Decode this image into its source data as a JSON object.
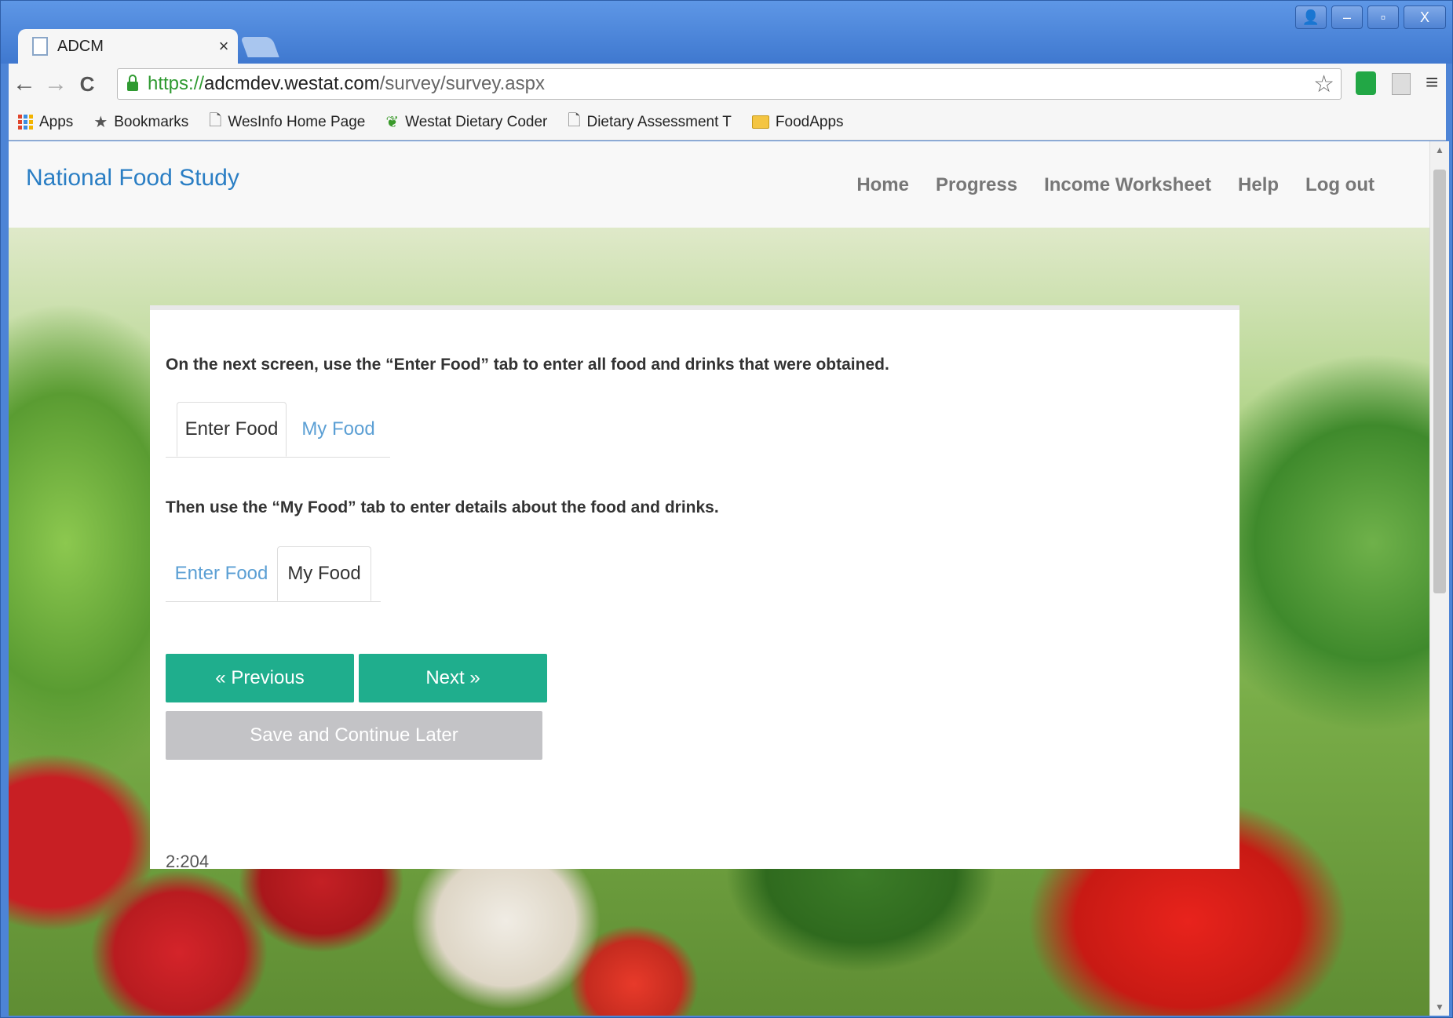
{
  "browser": {
    "tab_title": "ADCM",
    "tab_close": "×",
    "url_scheme": "https://",
    "url_host": "adcmdev.westat.com",
    "url_path": "/survey/survey.aspx",
    "window_controls": {
      "user": "👤",
      "minimize": "–",
      "maximize": "▫",
      "close": "X"
    },
    "nav": {
      "back": "←",
      "forward": "→",
      "reload": "C"
    },
    "star": "☆",
    "menu": "≡",
    "bookmarks": [
      {
        "label": "Apps"
      },
      {
        "label": "Bookmarks"
      },
      {
        "label": "WesInfo Home Page"
      },
      {
        "label": "Westat Dietary Coder"
      },
      {
        "label": "Dietary Assessment T"
      },
      {
        "label": "FoodApps"
      }
    ]
  },
  "site": {
    "brand": "National Food Study",
    "nav": [
      "Home",
      "Progress",
      "Income Worksheet",
      "Help",
      "Log out"
    ]
  },
  "content": {
    "instruction1": "On the next screen, use the “Enter Food” tab to enter all food and drinks that were obtained.",
    "instruction2": "Then use the “My Food” tab to enter details about the food and drinks.",
    "tabs_example1": [
      "Enter Food",
      "My Food"
    ],
    "tabs_example2": [
      "Enter Food",
      "My Food"
    ],
    "previous_label": "« Previous",
    "next_label": "Next »",
    "save_label": "Save and Continue Later",
    "screen_code": "2:204"
  },
  "colors": {
    "brand_blue": "#2a7ec4",
    "button_green": "#1fae8d",
    "button_gray": "#c3c3c6",
    "inactive_tab": "#5b9fd4"
  }
}
